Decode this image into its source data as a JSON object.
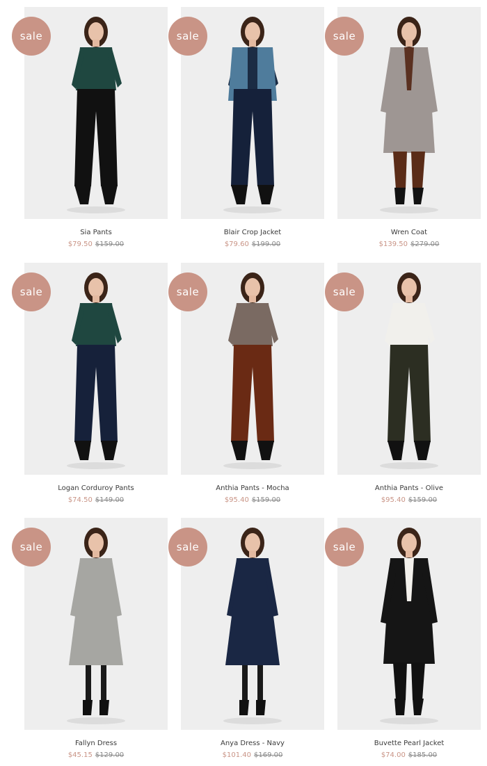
{
  "badge_label": "sale",
  "colors": {
    "badge": "#c99486",
    "sale_price": "#c99486",
    "background": "#ffffff",
    "photo_bg": "#eeeeee"
  },
  "products": [
    {
      "name": "Sia Pants",
      "sale_price": "$79.50",
      "original_price": "$159.00",
      "look": {
        "top": "#1f4740",
        "bottom": "#111111",
        "outer": null,
        "shoes": "#111111",
        "type": "pants"
      }
    },
    {
      "name": "Blair Crop Jacket",
      "sale_price": "$79.60",
      "original_price": "$199.00",
      "look": {
        "top": "#1b2c44",
        "bottom": "#15213a",
        "outer": "#4f7c9c",
        "shoes": "#111111",
        "type": "pants"
      }
    },
    {
      "name": "Wren Coat",
      "sale_price": "$139.50",
      "original_price": "$279.00",
      "look": {
        "top": "#5a3020",
        "bottom": "#5a2c18",
        "outer": "#9e9693",
        "shoes": "#111111",
        "type": "coat"
      }
    },
    {
      "name": "Logan Corduroy Pants",
      "sale_price": "$74.50",
      "original_price": "$149.00",
      "look": {
        "top": "#1f4740",
        "bottom": "#16213a",
        "outer": null,
        "shoes": "#111111",
        "type": "pants"
      }
    },
    {
      "name": "Anthia Pants - Mocha",
      "sale_price": "$95.40",
      "original_price": "$159.00",
      "look": {
        "top": "#7a6a62",
        "bottom": "#6a2a14",
        "outer": null,
        "shoes": "#111111",
        "type": "pants"
      }
    },
    {
      "name": "Anthia Pants - Olive",
      "sale_price": "$95.40",
      "original_price": "$159.00",
      "look": {
        "top": "#f1f0ec",
        "bottom": "#2c2e22",
        "outer": null,
        "shoes": "#111111",
        "type": "pants"
      }
    },
    {
      "name": "Fallyn Dress",
      "sale_price": "$45.15",
      "original_price": "$129.00",
      "look": {
        "top": "#a6a6a2",
        "bottom": "#a6a6a2",
        "outer": null,
        "shoes": "#111111",
        "type": "dress"
      }
    },
    {
      "name": "Anya Dress - Navy",
      "sale_price": "$101.40",
      "original_price": "$169.00",
      "look": {
        "top": "#1a2744",
        "bottom": "#1a2744",
        "outer": null,
        "shoes": "#111111",
        "type": "dress"
      }
    },
    {
      "name": "Buvette Pearl Jacket",
      "sale_price": "$74.00",
      "original_price": "$185.00",
      "look": {
        "top": "#f3f1ec",
        "bottom": "#111111",
        "outer": "#151515",
        "shoes": "#111111",
        "type": "coat"
      }
    }
  ]
}
